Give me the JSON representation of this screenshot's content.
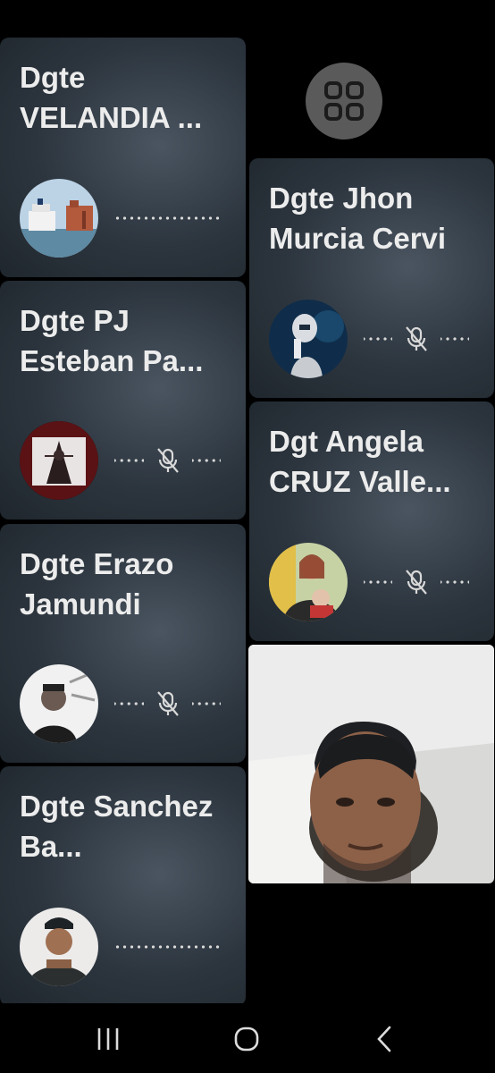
{
  "participants": [
    {
      "name": "Dgte VELANDIA ...",
      "muted": false,
      "avatar_icon": "avatar-cruise-ship-icon"
    },
    {
      "name": "Dgte PJ Esteban Pa...",
      "muted": true,
      "avatar_icon": "avatar-justice-statue-icon"
    },
    {
      "name": "Dgte Erazo Jamundi",
      "muted": true,
      "avatar_icon": "avatar-man-sketch-icon"
    },
    {
      "name": "Dgte Sanchez Ba...",
      "muted": false,
      "avatar_icon": "avatar-uniformed-man-icon"
    },
    {
      "name": "Dgte Jhon Murcia Cervi",
      "muted": true,
      "avatar_icon": "avatar-robot-icon"
    },
    {
      "name": "Dgt Angela CRUZ Valle...",
      "muted": true,
      "avatar_icon": "avatar-woman-child-icon"
    }
  ],
  "layout_button": {
    "icon": "grid-layout-icon"
  },
  "self_view": {
    "icon": "camera-self-view"
  },
  "navbar": {
    "recents_icon": "recents-icon",
    "home_icon": "home-icon",
    "back_icon": "back-icon"
  },
  "colors": {
    "tile_bg": "#2c353e",
    "text": "#ececec",
    "indicator": "#d8d8d8"
  }
}
